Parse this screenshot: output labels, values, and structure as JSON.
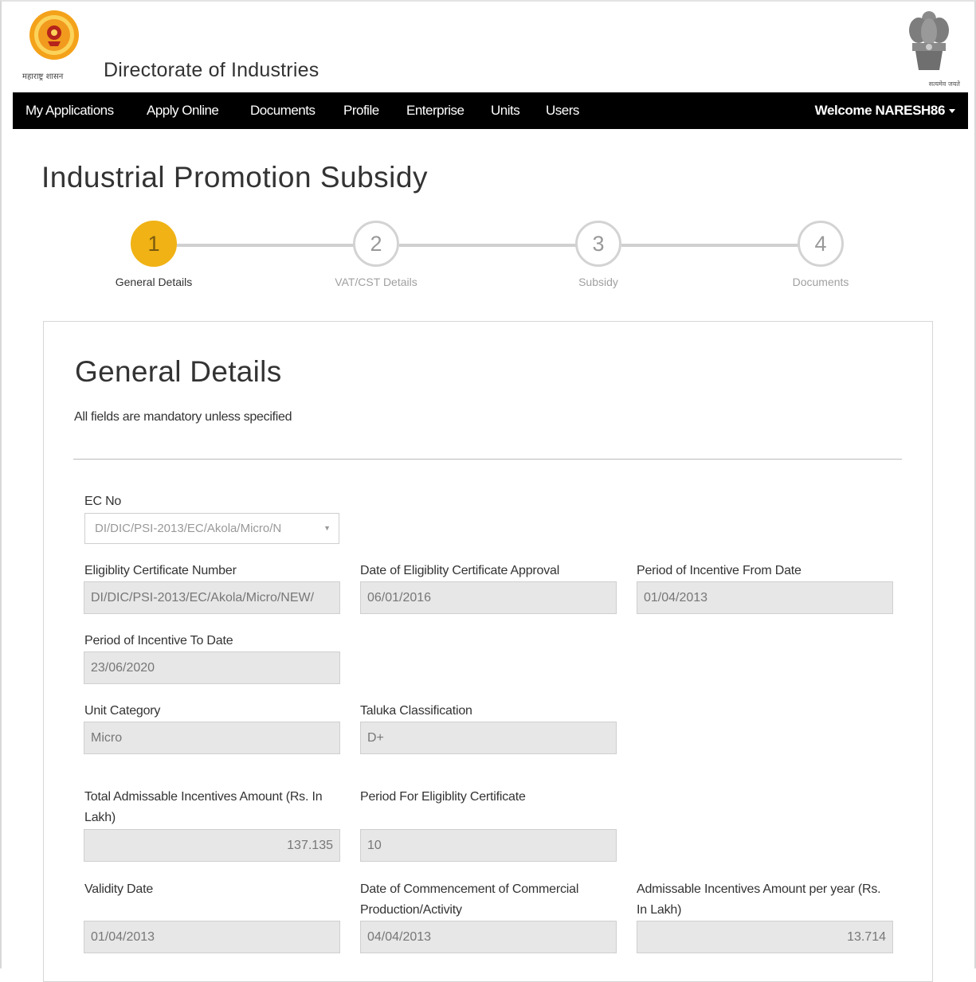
{
  "header": {
    "gov_label": "महाराष्ट्र शासन",
    "title": "Directorate of Industries",
    "national_label": "सत्यमेव जयते"
  },
  "nav": {
    "items": [
      "My Applications",
      "Apply Online",
      "Documents",
      "Profile",
      "Enterprise",
      "Units",
      "Users"
    ],
    "welcome": "Welcome NARESH86"
  },
  "page": {
    "title": "Industrial Promotion Subsidy"
  },
  "wizard": {
    "active_step": 1,
    "steps": [
      {
        "number": "1",
        "label": "General Details"
      },
      {
        "number": "2",
        "label": "VAT/CST Details"
      },
      {
        "number": "3",
        "label": "Subsidy"
      },
      {
        "number": "4",
        "label": "Documents"
      }
    ]
  },
  "form": {
    "title": "General Details",
    "note": "All fields are mandatory unless specified",
    "ec_no": {
      "label": "EC No",
      "value": "DI/DIC/PSI-2013/EC/Akola/Micro/N"
    },
    "fields": {
      "eligibility_cert_number": {
        "label": "Eligiblity Certificate Number",
        "value": "DI/DIC/PSI-2013/EC/Akola/Micro/NEW/"
      },
      "eligibility_cert_approval_date": {
        "label": "Date of Eligiblity Certificate Approval",
        "value": "06/01/2016"
      },
      "incentive_from_date": {
        "label": "Period of Incentive From Date",
        "value": "01/04/2013"
      },
      "incentive_to_date": {
        "label": "Period of Incentive To Date",
        "value": "23/06/2020"
      },
      "unit_category": {
        "label": "Unit Category",
        "value": "Micro"
      },
      "taluka_classification": {
        "label": "Taluka Classification",
        "value": "D+"
      },
      "total_admissable_incentives": {
        "label": "Total Admissable Incentives Amount (Rs. In Lakh)",
        "value": "137.135"
      },
      "period_for_eligibility": {
        "label": "Period For Eligiblity Certificate",
        "value": "10"
      },
      "validity_date": {
        "label": "Validity Date",
        "value": "01/04/2013"
      },
      "commencement_date": {
        "label": "Date of Commencement of Commercial Production/Activity",
        "value": "04/04/2013"
      },
      "incentives_per_year": {
        "label": "Admissable Incentives Amount per year (Rs. In Lakh)",
        "value": "13.714"
      }
    }
  },
  "colors": {
    "navbar": "#000000",
    "active_step": "#f0b214",
    "input_bg": "#e7e7e7"
  }
}
